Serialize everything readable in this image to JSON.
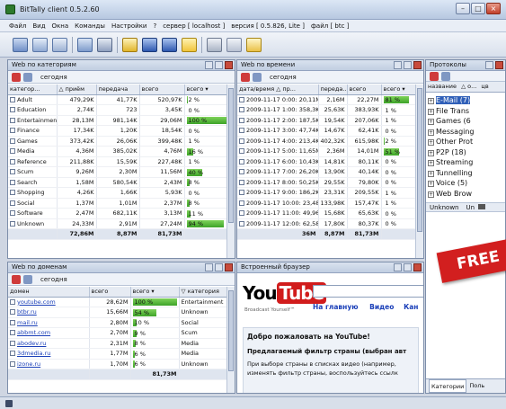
{
  "window": {
    "title": "BitTally client 0.5.2.60",
    "controls": {
      "minimize": "–",
      "maximize": "□",
      "close": "×"
    }
  },
  "menu": {
    "items": [
      "Файл",
      "Вид",
      "Окна",
      "Команды",
      "Настройки",
      "?",
      "сервер [ localhost ]",
      "версия [ 0.5.826, Lite ]",
      "файл [ btc ]"
    ]
  },
  "panels": {
    "categories": {
      "title": "Web по категориям",
      "toolbar_label": "сегодня",
      "columns": [
        "категор...",
        "△ приём",
        "передача",
        "всего",
        "всего ▾"
      ],
      "rows": [
        {
          "name": "Adult",
          "recv": "479,29K",
          "send": "41,77K",
          "total": "520,97K",
          "pct": "2 %",
          "fill": 0.02
        },
        {
          "name": "Education",
          "recv": "2,74K",
          "send": "723",
          "total": "3,45K",
          "pct": "0 %",
          "fill": 0
        },
        {
          "name": "Entertainment",
          "recv": "28,13M",
          "send": "981,14K",
          "total": "29,06M",
          "pct": "100 %",
          "fill": 1.0
        },
        {
          "name": "Finance",
          "recv": "17,34K",
          "send": "1,20K",
          "total": "18,54K",
          "pct": "0 %",
          "fill": 0
        },
        {
          "name": "Games",
          "recv": "373,42K",
          "send": "26,06K",
          "total": "399,48K",
          "pct": "1 %",
          "fill": 0.01
        },
        {
          "name": "Media",
          "recv": "4,36M",
          "send": "385,02K",
          "total": "4,76M",
          "pct": "16 %",
          "fill": 0.16
        },
        {
          "name": "Reference",
          "recv": "211,88K",
          "send": "15,59K",
          "total": "227,48K",
          "pct": "1 %",
          "fill": 0.01
        },
        {
          "name": "Scum",
          "recv": "9,26M",
          "send": "2,30M",
          "total": "11,56M",
          "pct": "40 %",
          "fill": 0.4
        },
        {
          "name": "Search",
          "recv": "1,58M",
          "send": "580,54K",
          "total": "2,43M",
          "pct": "8 %",
          "fill": 0.08
        },
        {
          "name": "Shopping",
          "recv": "4,26K",
          "send": "1,66K",
          "total": "5,93K",
          "pct": "0 %",
          "fill": 0
        },
        {
          "name": "Social",
          "recv": "1,37M",
          "send": "1,01M",
          "total": "2,37M",
          "pct": "8 %",
          "fill": 0.08
        },
        {
          "name": "Software",
          "recv": "2,47M",
          "send": "682,11K",
          "total": "3,13M",
          "pct": "11 %",
          "fill": 0.11
        },
        {
          "name": "Unknown",
          "recv": "24,33M",
          "send": "2,91M",
          "total": "27,24M",
          "pct": "94 %",
          "fill": 0.94
        }
      ],
      "totals": {
        "recv": "72,86M",
        "send": "8,87M",
        "total": "81,73M"
      }
    },
    "time": {
      "title": "Web по времени",
      "toolbar_label": "сегодня",
      "columns": [
        "дата/время",
        "△ пр...",
        "переда...",
        "всего",
        "всего ▾"
      ],
      "rows": [
        {
          "dt": "2009-11-17 0:00: 20,11M",
          "send": "2,16M",
          "total": "22,27M",
          "pct": "81 %",
          "fill": 0.81
        },
        {
          "dt": "2009-11-17 1:00: 358,3K",
          "send": "25,63K",
          "total": "383,93K",
          "pct": "1 %",
          "fill": 0.01
        },
        {
          "dt": "2009-11-17 2:00: 187,5K",
          "send": "19,54K",
          "total": "207,06K",
          "pct": "1 %",
          "fill": 0.01
        },
        {
          "dt": "2009-11-17 3:00: 47,74K",
          "send": "14,67K",
          "total": "62,41K",
          "pct": "0 %",
          "fill": 0
        },
        {
          "dt": "2009-11-17 4:00: 213,4K",
          "send": "402,32K",
          "total": "615,98K",
          "pct": "2 %",
          "fill": 0.02
        },
        {
          "dt": "2009-11-17 5:00: 11,65M",
          "send": "2,36M",
          "total": "14,01M",
          "pct": "51 %",
          "fill": 0.51
        },
        {
          "dt": "2009-11-17 6:00: 10,43K",
          "send": "14,81K",
          "total": "80,11K",
          "pct": "0 %",
          "fill": 0
        },
        {
          "dt": "2009-11-17 7:00: 26,20K",
          "send": "13,90K",
          "total": "40,14K",
          "pct": "0 %",
          "fill": 0
        },
        {
          "dt": "2009-11-17 8:00: 50,25K",
          "send": "29,55K",
          "total": "79,80K",
          "pct": "0 %",
          "fill": 0
        },
        {
          "dt": "2009-11-17 9:00: 186,2K",
          "send": "23,31K",
          "total": "209,55K",
          "pct": "1 %",
          "fill": 0.01
        },
        {
          "dt": "2009-11-17 10:00: 23,48K",
          "send": "133,98K",
          "total": "157,47K",
          "pct": "1 %",
          "fill": 0.01
        },
        {
          "dt": "2009-11-17 11:00: 49,96K",
          "send": "15,68K",
          "total": "65,63K",
          "pct": "0 %",
          "fill": 0
        },
        {
          "dt": "2009-11-17 12:00: 62,58K",
          "send": "17,80K",
          "total": "80,37K",
          "pct": "0 %",
          "fill": 0
        }
      ],
      "totals": {
        "recv": "36M",
        "send": "8,87M",
        "total": "81,73M"
      }
    },
    "protocols": {
      "title": "Протоколы",
      "columns": [
        "название",
        "△ о...",
        "цв"
      ],
      "items": [
        "E-Mail (7)",
        "File Trans",
        "Games (6",
        "Messaging",
        "Other Prot",
        "P2P (18)",
        "Streaming",
        "Tunnelling",
        "Voice (5)",
        "Web Brow"
      ],
      "unknown_row": [
        "Unknown",
        "Un"
      ],
      "tabs": [
        "Категории",
        "Поль"
      ]
    },
    "domains": {
      "title": "Web по доменам",
      "toolbar_label": "сегодня",
      "columns": [
        "домен",
        "всего",
        "всего ▾",
        "▽ категория"
      ],
      "rows": [
        {
          "domain": "youtube.com",
          "total": "28,62M",
          "pct": "100 %",
          "fill": 1.0,
          "cat": "Entertainment"
        },
        {
          "domain": "btbr.ru",
          "total": "15,66M",
          "pct": "54 %",
          "fill": 0.54,
          "cat": "Unknown"
        },
        {
          "domain": "mail.ru",
          "total": "2,80M",
          "pct": "10 %",
          "fill": 0.1,
          "cat": "Social"
        },
        {
          "domain": "abbmt.com",
          "total": "2,70M",
          "pct": "9 %",
          "fill": 0.09,
          "cat": "Scum"
        },
        {
          "domain": "abodev.ru",
          "total": "2,31M",
          "pct": "8 %",
          "fill": 0.08,
          "cat": "Media"
        },
        {
          "domain": "3dmedia.ru",
          "total": "1,77M",
          "pct": "6 %",
          "fill": 0.06,
          "cat": "Media"
        },
        {
          "domain": "izone.ru",
          "total": "1,70M",
          "pct": "6 %",
          "fill": 0.06,
          "cat": "Unknown"
        }
      ],
      "totals": {
        "total": "81,73M"
      }
    },
    "browser": {
      "title": "Встроенный браузер",
      "logo_you": "You",
      "logo_tube": "Tube",
      "tagline": "Broadcast Yourself™",
      "nav": [
        "На главную",
        "Видео",
        "Кан"
      ],
      "welcome": "Добро пожаловать на YouTube!",
      "filter_heading": "Предлагаемый фильтр страны (выбран авт",
      "filter_text": "При выборе страны в списках видео (например,",
      "filter_text2": "изменять фильтр страны, воспользуйтесь ссылк"
    }
  },
  "overlay": {
    "badge": "FREE"
  },
  "colors": {
    "accent_bar": "#3da329",
    "selected": "#2f5fb8",
    "youtube_red": "#d11c1c",
    "badge_red": "#d21f1f"
  }
}
